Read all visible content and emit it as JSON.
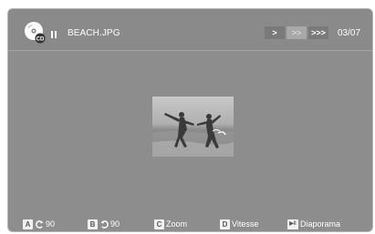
{
  "header": {
    "title": "BEACH.JPG",
    "speed_buttons": [
      ">",
      ">>",
      ">>>"
    ],
    "counter": "03/07",
    "cd_icon_label": "CD"
  },
  "footer": {
    "buttons": [
      {
        "key": "A",
        "icon": "rotate-left-icon",
        "label": "90"
      },
      {
        "key": "B",
        "icon": "rotate-right-icon",
        "label": "90"
      },
      {
        "key": "C",
        "label": "Zoom"
      },
      {
        "key": "D",
        "label": "Vitesse"
      },
      {
        "key": "▶‖",
        "label": "Diaporama"
      }
    ]
  },
  "colors": {
    "background": "#8d8d8d",
    "text": "#ffffff"
  }
}
